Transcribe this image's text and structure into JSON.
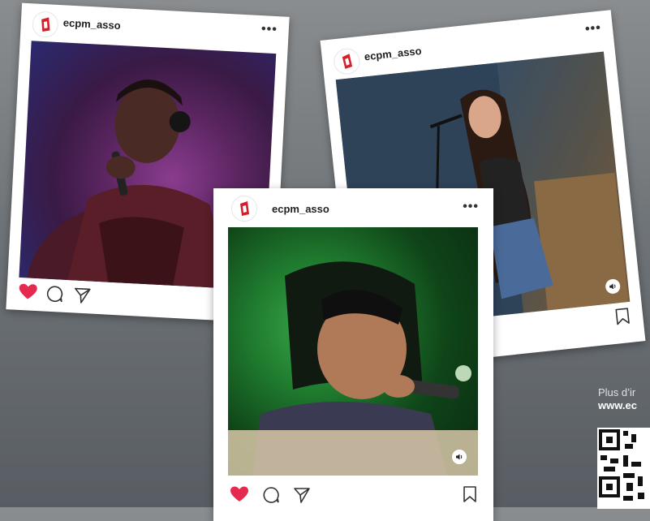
{
  "posts": [
    {
      "username": "ecpm_asso",
      "more": "•••",
      "liked": true,
      "has_sound": false
    },
    {
      "username": "ecpm_asso",
      "more": "•••",
      "liked": false,
      "has_sound": true
    },
    {
      "username": "ecpm_asso",
      "more": "•••",
      "liked": true,
      "has_sound": true
    }
  ],
  "info": {
    "text": "Plus d’ir",
    "url": "www.ec"
  },
  "colors": {
    "like": "#e6294f",
    "brand": "#d4202a",
    "icon": "#333333"
  },
  "icons": {
    "like": "heart-icon",
    "comment": "comment-icon",
    "share": "share-icon",
    "save": "bookmark-icon",
    "sound": "speaker-icon",
    "more": "more-icon"
  }
}
